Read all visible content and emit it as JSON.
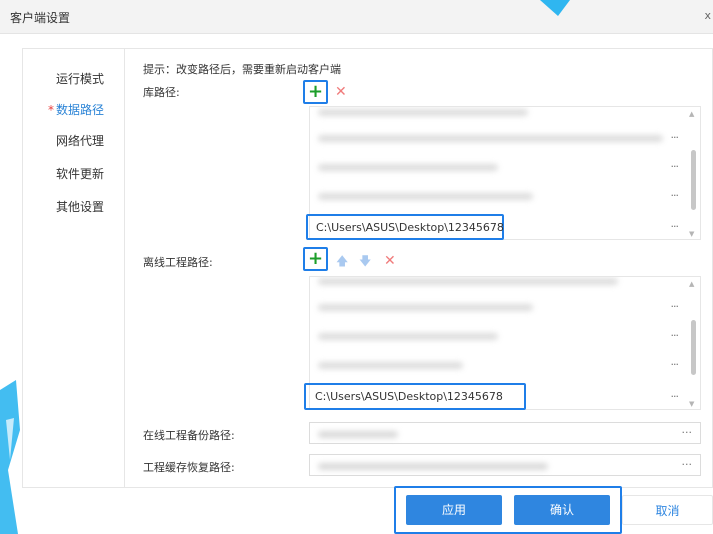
{
  "window": {
    "title": "客户端设置",
    "close_label": "x"
  },
  "sidebar": {
    "items": [
      {
        "label": "运行模式",
        "active": false
      },
      {
        "label": "数据路径",
        "active": true,
        "required_mark": "*"
      },
      {
        "label": "网络代理",
        "active": false
      },
      {
        "label": "软件更新",
        "active": false
      },
      {
        "label": "其他设置",
        "active": false
      }
    ]
  },
  "main": {
    "hint": "提示：改变路径后，需要重新启动客户端",
    "library": {
      "label": "库路径:",
      "add_icon": "plus-icon",
      "remove_icon": "close-icon",
      "selected_path": "C:\\Users\\ASUS\\Desktop\\12345678",
      "more_label": "···"
    },
    "offline": {
      "label": "离线工程路径:",
      "add_icon": "plus-icon",
      "up_icon": "arrow-up-icon",
      "down_icon": "arrow-down-icon",
      "remove_icon": "close-icon",
      "selected_path": "C:\\Users\\ASUS\\Desktop\\12345678",
      "more_label": "···"
    },
    "online_backup": {
      "label": "在线工程备份路径:",
      "more_label": "···"
    },
    "cache_restore": {
      "label": "工程缓存恢复路径:",
      "more_label": "···"
    }
  },
  "footer": {
    "apply_label": "应用",
    "confirm_label": "确认",
    "cancel_label": "取消"
  },
  "colors": {
    "accent": "#2f86e0",
    "highlight_border": "#1f7ee8",
    "add_green": "#1c9e2a",
    "remove_red": "#f07b7b",
    "active_nav": "#2a83d6"
  }
}
